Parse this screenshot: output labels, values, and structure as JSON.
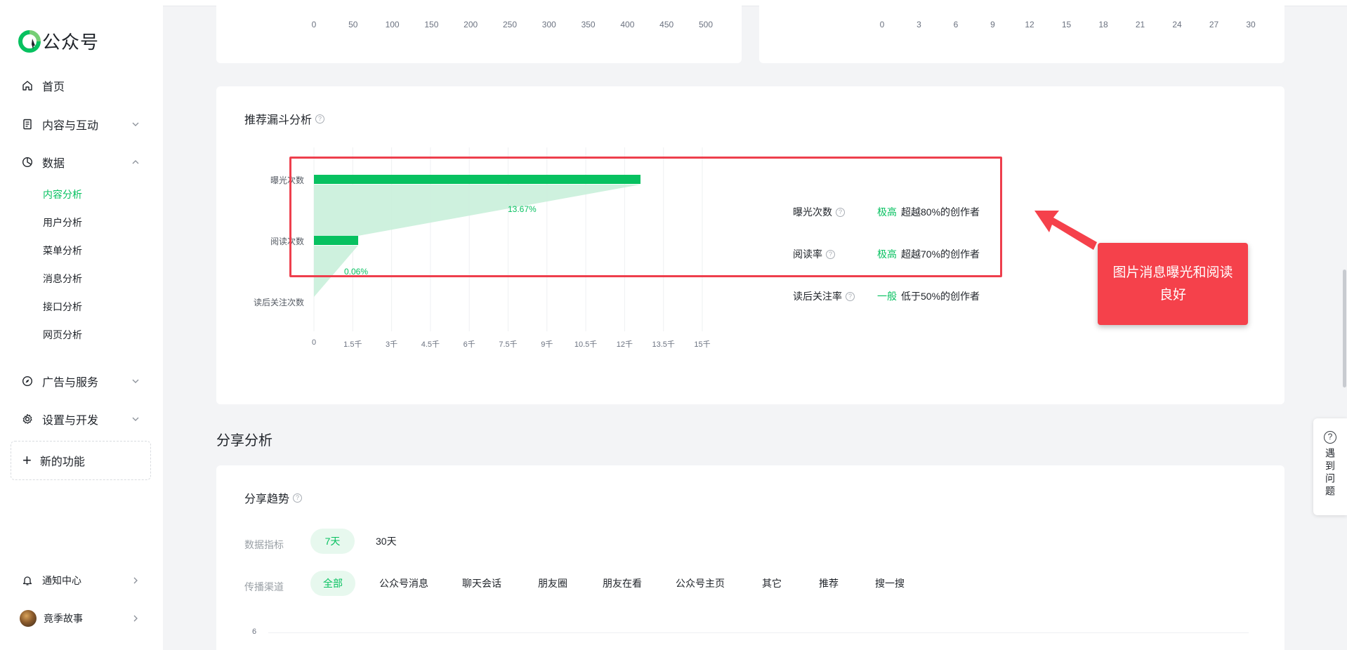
{
  "app": {
    "logo_text": "公众号",
    "brand_color": "#07c160"
  },
  "sidebar": {
    "home": "首页",
    "content_interaction": "内容与互动",
    "data": "数据",
    "data_sub": [
      "内容分析",
      "用户分析",
      "菜单分析",
      "消息分析",
      "接口分析",
      "网页分析"
    ],
    "ads_services": "广告与服务",
    "settings_dev": "设置与开发",
    "new_feature": "新的功能",
    "notification_center": "通知中心",
    "account_name": "竟季故事"
  },
  "top_charts": {
    "left_ticks": [
      "0",
      "50",
      "100",
      "150",
      "200",
      "250",
      "300",
      "350",
      "400",
      "450",
      "500"
    ],
    "right_ticks": [
      "0",
      "3",
      "6",
      "9",
      "12",
      "15",
      "18",
      "21",
      "24",
      "27",
      "30"
    ]
  },
  "funnel": {
    "title": "推荐漏斗分析",
    "chart_data": {
      "type": "bar",
      "categories": [
        "曝光次数",
        "阅读次数",
        "读后关注次数"
      ],
      "values": [
        12600,
        1700,
        1
      ],
      "conversion_labels": [
        "13.67%",
        "0.06%"
      ],
      "x_ticks": [
        "0",
        "1.5千",
        "3千",
        "4.5千",
        "6千",
        "7.5千",
        "9千",
        "10.5千",
        "12千",
        "13.5千",
        "15千"
      ],
      "xlim": [
        0,
        15000
      ]
    },
    "metrics": [
      {
        "name": "曝光次数",
        "level": "极高",
        "desc": "超越80%的创作者"
      },
      {
        "name": "阅读率",
        "level": "极高",
        "desc": "超越70%的创作者"
      },
      {
        "name": "读后关注率",
        "level": "一般",
        "desc": "低于50%的创作者"
      }
    ],
    "annotation": "图片消息曝光和阅读良好"
  },
  "share": {
    "section_title": "分享分析",
    "card_title": "分享趋势",
    "metric_label": "数据指标",
    "metric_options": [
      "7天",
      "30天"
    ],
    "channel_label": "传播渠道",
    "channels": [
      "全部",
      "公众号消息",
      "聊天会话",
      "朋友圈",
      "朋友在看",
      "公众号主页",
      "其它",
      "推荐",
      "搜一搜"
    ],
    "y_tick_top": "6"
  },
  "help_float": {
    "label": "遇到问题"
  }
}
